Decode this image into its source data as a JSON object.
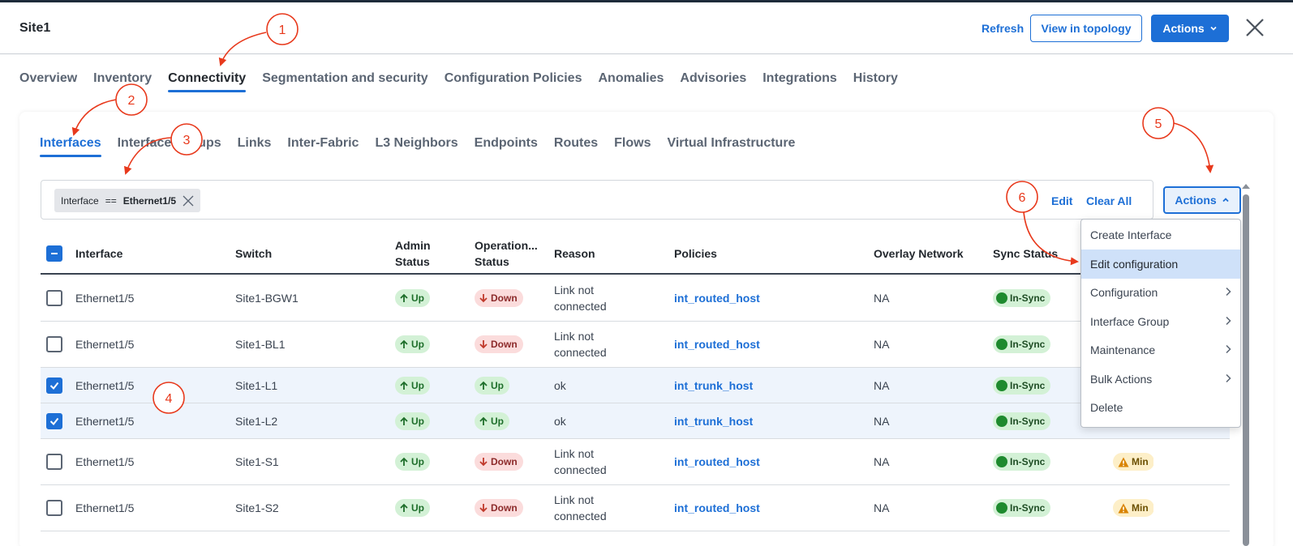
{
  "header": {
    "title": "Site1",
    "refresh_label": "Refresh",
    "topology_label": "View in topology",
    "actions_label": "Actions"
  },
  "main_tabs": [
    {
      "label": "Overview",
      "active": false
    },
    {
      "label": "Inventory",
      "active": false
    },
    {
      "label": "Connectivity",
      "active": true
    },
    {
      "label": "Segmentation and security",
      "active": false
    },
    {
      "label": "Configuration Policies",
      "active": false
    },
    {
      "label": "Anomalies",
      "active": false
    },
    {
      "label": "Advisories",
      "active": false
    },
    {
      "label": "Integrations",
      "active": false
    },
    {
      "label": "History",
      "active": false
    }
  ],
  "sub_tabs": [
    {
      "label": "Interfaces",
      "active": true
    },
    {
      "label": "Interface Groups",
      "active": false
    },
    {
      "label": "Links",
      "active": false
    },
    {
      "label": "Inter-Fabric",
      "active": false
    },
    {
      "label": "L3 Neighbors",
      "active": false
    },
    {
      "label": "Endpoints",
      "active": false
    },
    {
      "label": "Routes",
      "active": false
    },
    {
      "label": "Flows",
      "active": false
    },
    {
      "label": "Virtual Infrastructure",
      "active": false
    }
  ],
  "filter": {
    "chip_key": "Interface",
    "chip_op": "==",
    "chip_value": "Ethernet1/5",
    "edit_label": "Edit",
    "clear_label": "Clear All"
  },
  "table_actions_label": "Actions",
  "table": {
    "headers": {
      "interface": "Interface",
      "switch": "Switch",
      "admin_status_1": "Admin",
      "admin_status_2": "Status",
      "oper_status_1": "Operation...",
      "oper_status_2": "Status",
      "reason": "Reason",
      "policies": "Policies",
      "overlay": "Overlay Network",
      "sync": "Sync Status"
    },
    "rows": [
      {
        "checked": false,
        "interface": "Ethernet1/5",
        "switch": "Site1-BGW1",
        "admin": "Up",
        "oper": "Down",
        "reason_1": "Link not",
        "reason_2": "connected",
        "policy": "int_routed_host",
        "overlay": "NA",
        "sync": "In-Sync",
        "anomaly": ""
      },
      {
        "checked": false,
        "interface": "Ethernet1/5",
        "switch": "Site1-BL1",
        "admin": "Up",
        "oper": "Down",
        "reason_1": "Link not",
        "reason_2": "connected",
        "policy": "int_routed_host",
        "overlay": "NA",
        "sync": "In-Sync",
        "anomaly": ""
      },
      {
        "checked": true,
        "interface": "Ethernet1/5",
        "switch": "Site1-L1",
        "admin": "Up",
        "oper": "Up",
        "reason_1": "ok",
        "reason_2": "",
        "policy": "int_trunk_host",
        "overlay": "NA",
        "sync": "In-Sync",
        "anomaly": ""
      },
      {
        "checked": true,
        "interface": "Ethernet1/5",
        "switch": "Site1-L2",
        "admin": "Up",
        "oper": "Up",
        "reason_1": "ok",
        "reason_2": "",
        "policy": "int_trunk_host",
        "overlay": "NA",
        "sync": "In-Sync",
        "anomaly": ""
      },
      {
        "checked": false,
        "interface": "Ethernet1/5",
        "switch": "Site1-S1",
        "admin": "Up",
        "oper": "Down",
        "reason_1": "Link not",
        "reason_2": "connected",
        "policy": "int_routed_host",
        "overlay": "NA",
        "sync": "In-Sync",
        "anomaly": "Min"
      },
      {
        "checked": false,
        "interface": "Ethernet1/5",
        "switch": "Site1-S2",
        "admin": "Up",
        "oper": "Down",
        "reason_1": "Link not",
        "reason_2": "connected",
        "policy": "int_routed_host",
        "overlay": "NA",
        "sync": "In-Sync",
        "anomaly": "Min"
      }
    ]
  },
  "actions_menu": [
    {
      "label": "Create Interface",
      "submenu": false,
      "highlighted": false
    },
    {
      "label": "Edit configuration",
      "submenu": false,
      "highlighted": true
    },
    {
      "label": "Configuration",
      "submenu": true,
      "highlighted": false
    },
    {
      "label": "Interface Group",
      "submenu": true,
      "highlighted": false
    },
    {
      "label": "Maintenance",
      "submenu": true,
      "highlighted": false
    },
    {
      "label": "Bulk Actions",
      "submenu": true,
      "highlighted": false
    },
    {
      "label": "Delete",
      "submenu": false,
      "highlighted": false
    }
  ],
  "callouts": [
    "1",
    "2",
    "3",
    "4",
    "5",
    "6"
  ],
  "colors": {
    "accent": "#1d6fd6",
    "annotation": "#e8391c",
    "up_badge": "#d3f1d6",
    "down_badge": "#fbdcdc",
    "warn_badge": "#fdefc8"
  }
}
